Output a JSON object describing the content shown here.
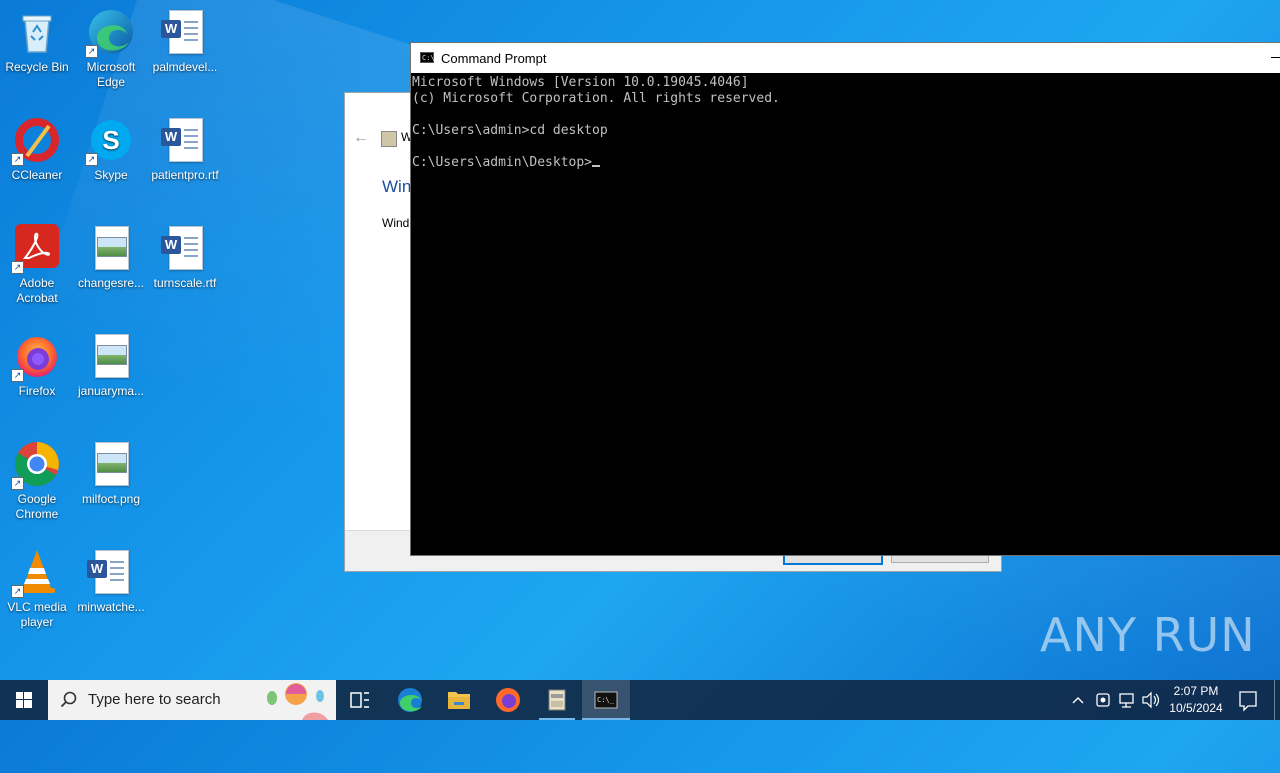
{
  "desktop": {
    "icons": [
      {
        "label": "Recycle Bin",
        "icon": "recycle-bin-icon"
      },
      {
        "label": "Microsoft Edge",
        "icon": "edge-icon"
      },
      {
        "label": "palmdevel...",
        "icon": "word-document-icon"
      },
      {
        "label": "CCleaner",
        "icon": "ccleaner-icon"
      },
      {
        "label": "Skype",
        "icon": "skype-icon"
      },
      {
        "label": "patientpro.rtf",
        "icon": "word-document-icon"
      },
      {
        "label": "Adobe Acrobat",
        "icon": "acrobat-icon"
      },
      {
        "label": "changesre...",
        "icon": "image-file-icon"
      },
      {
        "label": "turnscale.rtf",
        "icon": "word-document-icon"
      },
      {
        "label": "Firefox",
        "icon": "firefox-icon"
      },
      {
        "label": "januaryma...",
        "icon": "image-file-icon"
      },
      {
        "label": "Google Chrome",
        "icon": "chrome-icon"
      },
      {
        "label": "milfoct.png",
        "icon": "image-file-icon"
      },
      {
        "label": "VLC media player",
        "icon": "vlc-icon"
      },
      {
        "label": "minwatche...",
        "icon": "word-document-icon"
      }
    ]
  },
  "background_window": {
    "title_partial": "W",
    "heading_partial": "Win",
    "text_partial": "Wind"
  },
  "cmd": {
    "title": "Command Prompt",
    "lines": [
      "Microsoft Windows [Version 10.0.19045.4046]",
      "(c) Microsoft Corporation. All rights reserved.",
      "",
      "C:\\Users\\admin>cd desktop",
      "",
      "C:\\Users\\admin\\Desktop>"
    ]
  },
  "taskbar": {
    "search_placeholder": "Type here to search",
    "apps": [
      "task-view-icon",
      "edge-icon",
      "file-explorer-icon",
      "firefox-icon",
      "package-icon",
      "cmd-icon"
    ],
    "time": "2:07 PM",
    "date": "10/5/2024"
  },
  "watermark": "ANY RUN",
  "colors": {
    "accent": "#0078d7",
    "console_bg": "#000000",
    "console_fg": "#c0c0c0"
  }
}
